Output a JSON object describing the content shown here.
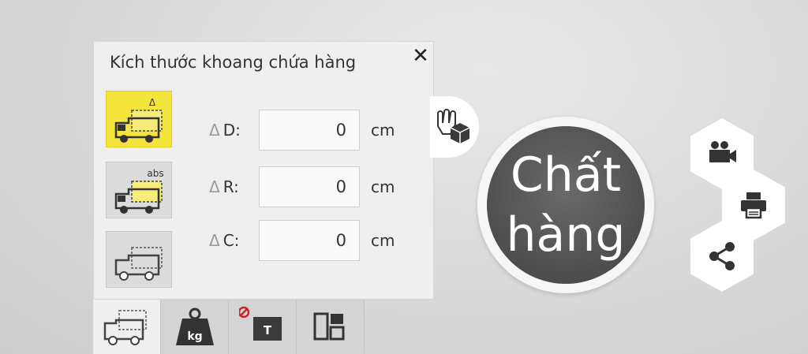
{
  "panel": {
    "title": "Kích thước khoang chứa hàng",
    "close_symbol": "✕",
    "modes": [
      {
        "icon": "truck-delta-icon",
        "badge": "Δ",
        "active": true
      },
      {
        "icon": "truck-abs-icon",
        "badge": "abs",
        "active": false
      },
      {
        "icon": "truck-outline-icon",
        "badge": "",
        "active": false
      }
    ],
    "fields": [
      {
        "prefix": "Δ",
        "label": "D:",
        "value": "0",
        "unit": "cm"
      },
      {
        "prefix": "Δ",
        "label": "R:",
        "value": "0",
        "unit": "cm"
      },
      {
        "prefix": "Δ",
        "label": "C:",
        "value": "0",
        "unit": "cm"
      }
    ]
  },
  "tabs": [
    {
      "icon": "truck-dimensions-icon",
      "active": true
    },
    {
      "icon": "weight-kg-icon",
      "label": "kg",
      "active": false
    },
    {
      "icon": "no-stack-icon",
      "label": "T",
      "active": false
    },
    {
      "icon": "layout-icon",
      "active": false
    }
  ],
  "load_button": {
    "line1": "Chất",
    "line2": "hàng"
  },
  "side_buttons": [
    "camera-icon",
    "print-icon",
    "share-icon"
  ],
  "colors": {
    "accent_yellow": "#f4e43c",
    "disabled_red": "#d0202a",
    "dark_circle": "#4e4e4e"
  }
}
